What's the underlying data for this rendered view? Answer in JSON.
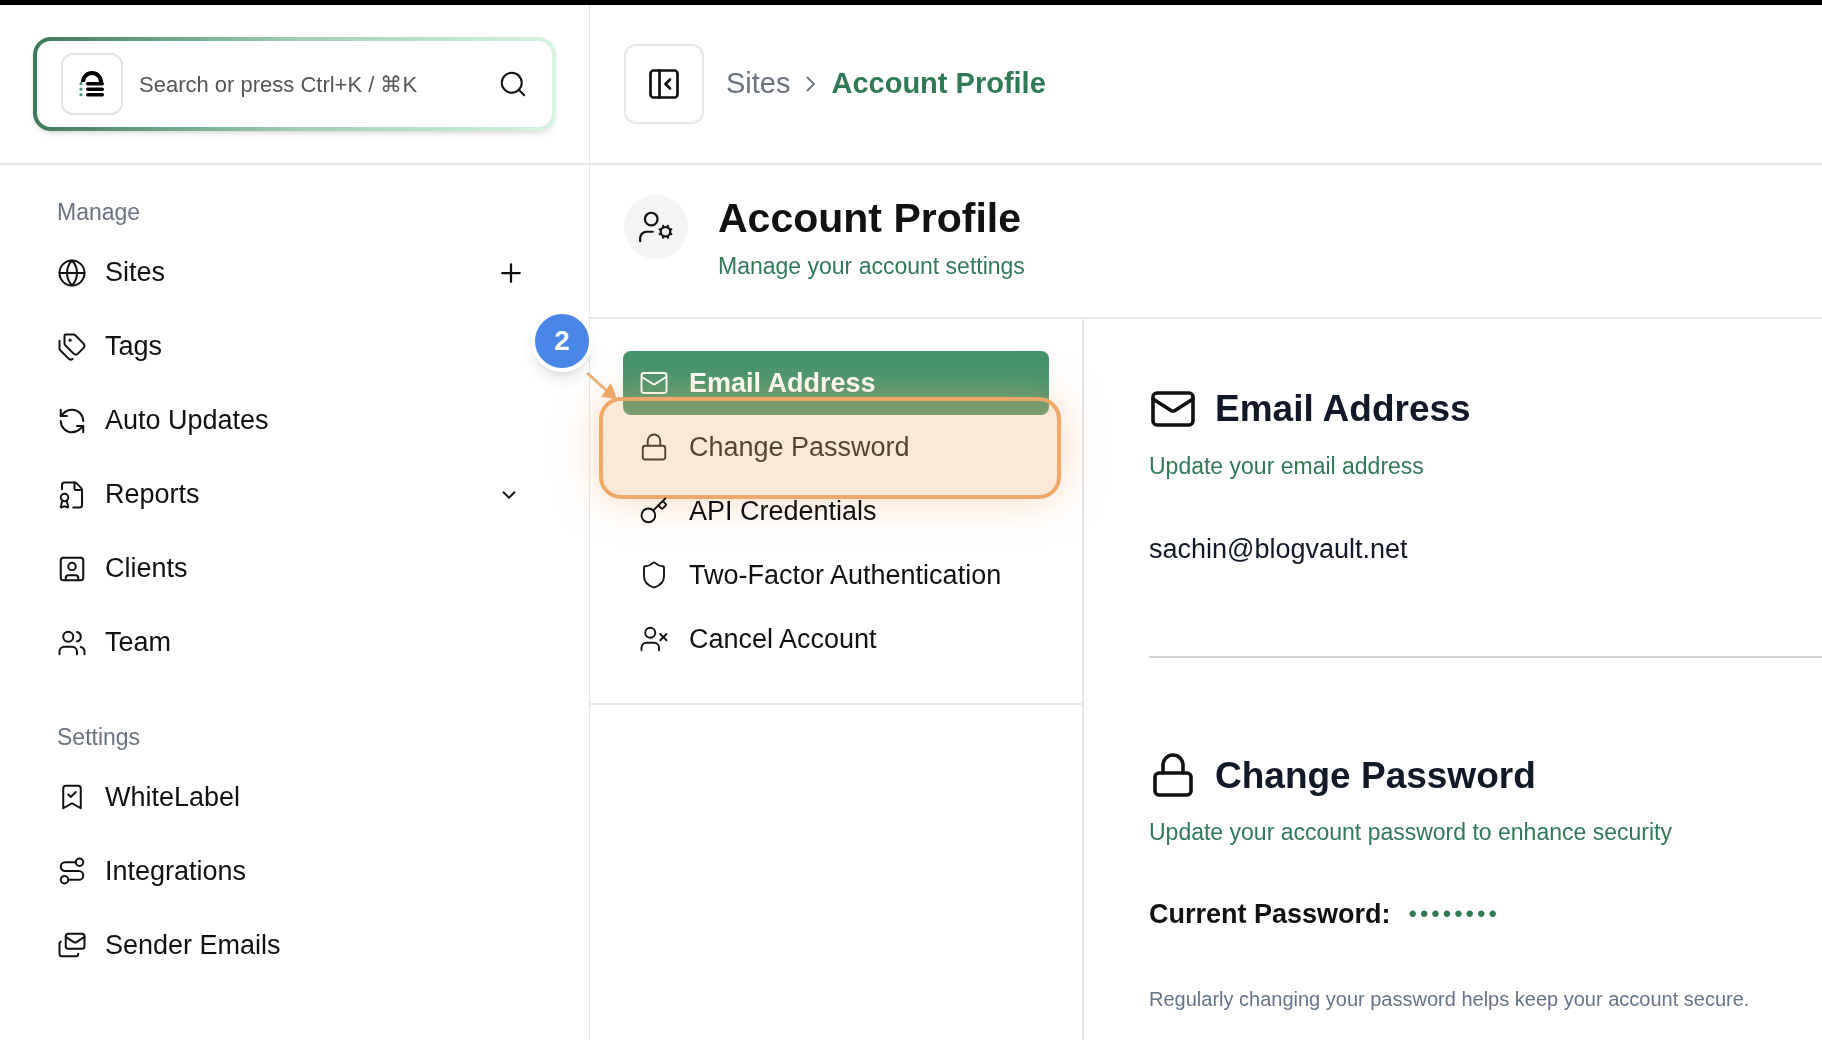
{
  "search": {
    "placeholder": "Search or press Ctrl+K / ⌘K"
  },
  "breadcrumb": [
    {
      "label": "Sites",
      "selected": false
    },
    {
      "label": "Account Profile",
      "selected": true
    }
  ],
  "sidebar": {
    "sections": [
      {
        "title": "Manage",
        "items": [
          {
            "label": "Sites",
            "kind": "add"
          },
          {
            "label": "Tags"
          },
          {
            "label": "Auto Updates"
          },
          {
            "label": "Reports",
            "kind": "expand"
          },
          {
            "label": "Clients"
          },
          {
            "label": "Team"
          }
        ]
      },
      {
        "title": "Settings",
        "items": [
          {
            "label": "WhiteLabel"
          },
          {
            "label": "Integrations"
          },
          {
            "label": "Sender Emails"
          }
        ]
      }
    ]
  },
  "page": {
    "title": "Account Profile",
    "subtitle": "Manage your account settings"
  },
  "menu": [
    {
      "label": "Email Address",
      "selected": true,
      "highlighted": false
    },
    {
      "label": "Change Password",
      "selected": false,
      "highlighted": true
    },
    {
      "label": "API Credentials",
      "selected": false,
      "highlighted": false
    },
    {
      "label": "Two-Factor Authentication",
      "selected": false,
      "highlighted": false
    },
    {
      "label": "Cancel Account",
      "selected": false,
      "highlighted": false
    }
  ],
  "tour": {
    "step": "2"
  },
  "email_section": {
    "title": "Email Address",
    "subtitle": "Update your email address",
    "value": "sachin@blogvault.net"
  },
  "password_section": {
    "title": "Change Password",
    "subtitle": "Update your account password to enhance security",
    "label": "Current Password:",
    "value": "••••••••",
    "note": "Regularly changing your password helps keep your account secure."
  }
}
